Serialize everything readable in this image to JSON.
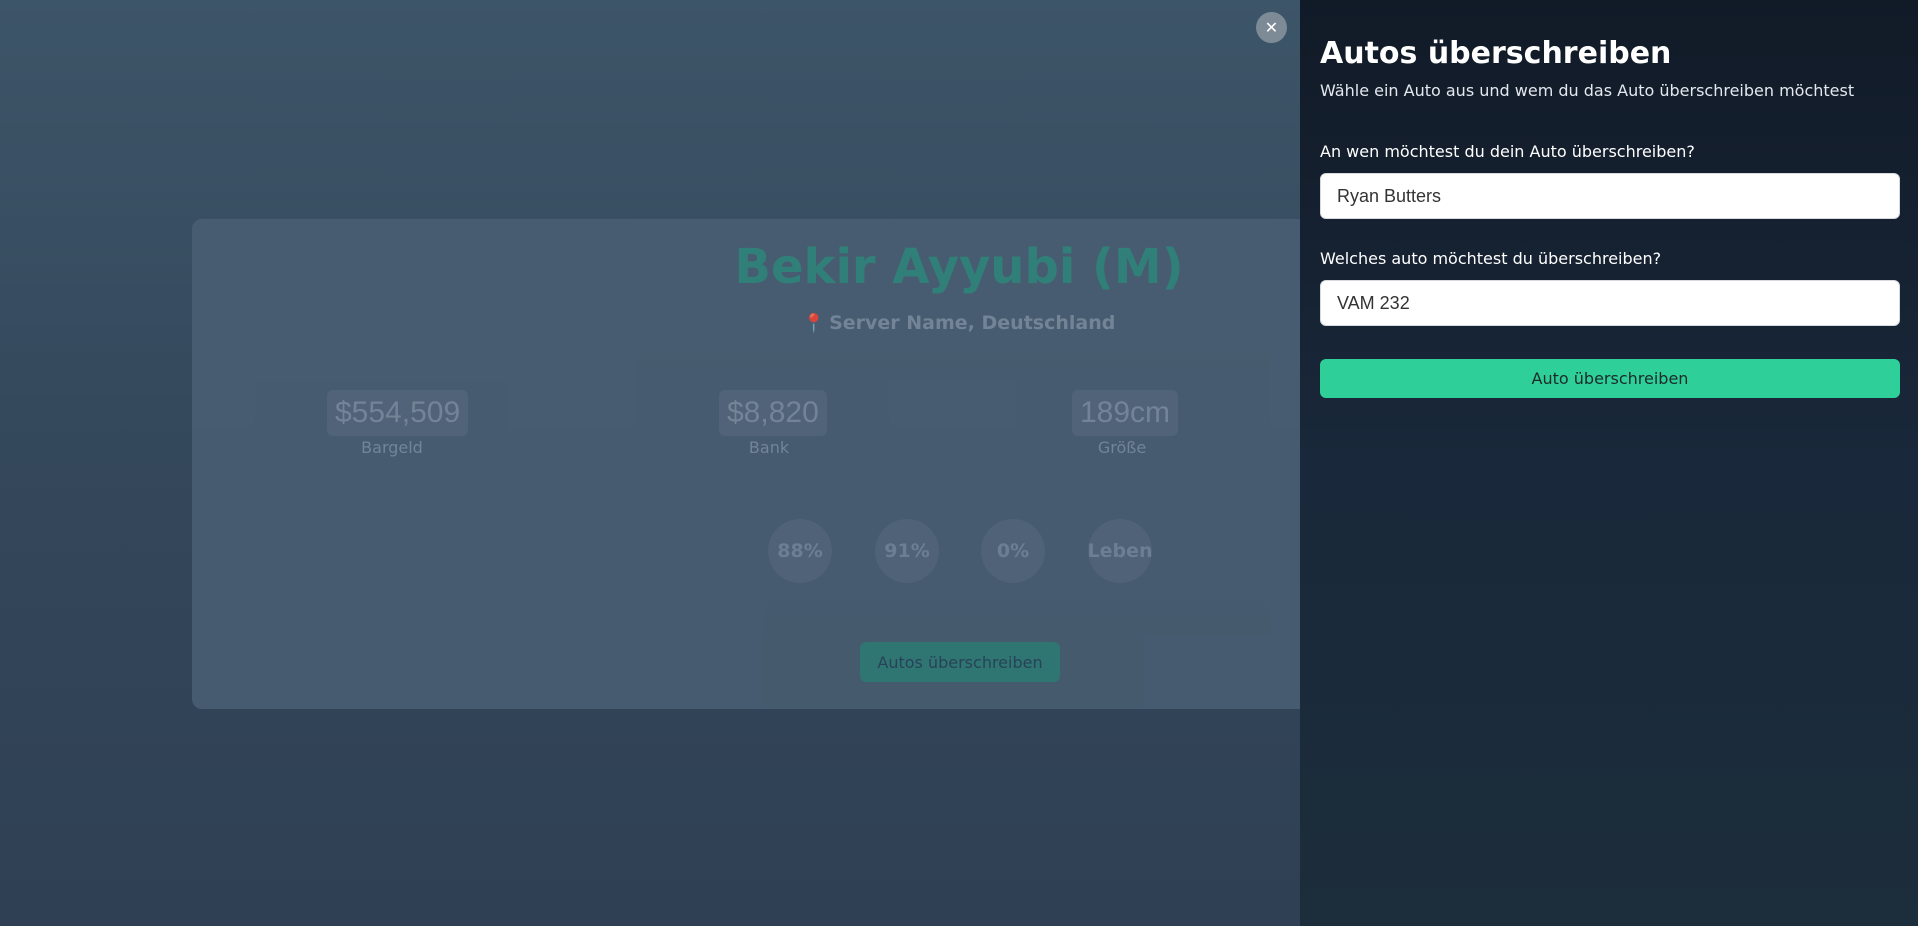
{
  "card": {
    "title": "Bekir Ayyubi (M)",
    "subtitle": "Server Name, Deutschland",
    "pin_icon": "map-pin-icon",
    "stats": [
      {
        "value": "$554,509",
        "label": "Bargeld"
      },
      {
        "value": "$8,820",
        "label": "Bank"
      },
      {
        "value": "189cm",
        "label": "Größe"
      }
    ],
    "circles": [
      "88%",
      "91%",
      "0%",
      "Leben"
    ],
    "button_label": "Autos überschreiben"
  },
  "close": {
    "icon": "close-icon",
    "glyph": "✕"
  },
  "panel": {
    "title": "Autos überschreiben",
    "description": "Wähle ein Auto aus und wem du das Auto überschreiben möchtest",
    "recipient": {
      "label": "An wen möchtest du dein Auto überschreiben?",
      "value": "Ryan Butters"
    },
    "vehicle": {
      "label": "Welches auto möchtest du überschreiben?",
      "value": "VAM 232"
    },
    "submit_label": "Auto überschreiben",
    "accent_color": "#2fcf99"
  }
}
